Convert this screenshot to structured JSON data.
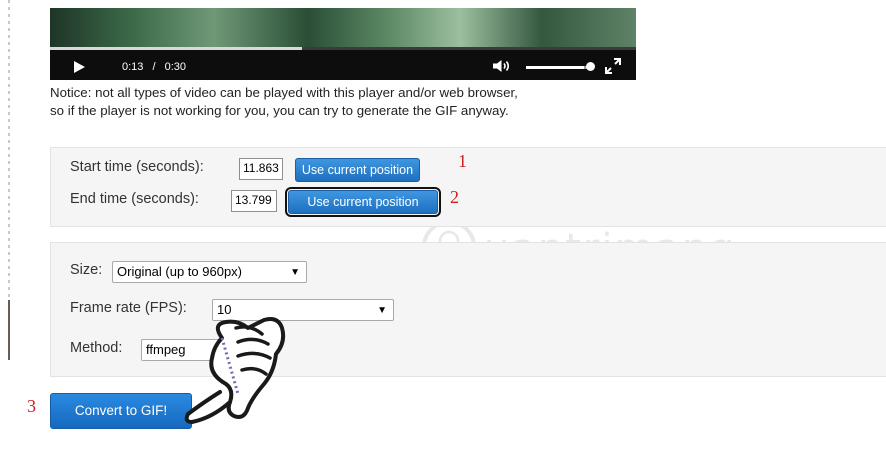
{
  "video": {
    "current_time": "0:13",
    "separator": "/",
    "duration": "0:30",
    "progress_fraction": 0.43,
    "volume_fraction": 0.9
  },
  "notice": {
    "line1": "Notice: not all types of video can be played with this player and/or web browser,",
    "line2": "so if the player is not working for you, you can try to generate the GIF anyway."
  },
  "timing": {
    "start_label": "Start time (seconds):",
    "start_value": "11.863",
    "end_label": "End time (seconds):",
    "end_value": "13.799",
    "use_position_label": "Use current position"
  },
  "options": {
    "size_label": "Size:",
    "size_value": "Original (up to 960px)",
    "fps_label": "Frame rate (FPS):",
    "fps_value": "10",
    "method_label": "Method:",
    "method_value": "ffmpeg"
  },
  "convert_label": "Convert to GIF!",
  "annotations": {
    "step1": "1",
    "step2": "2",
    "step3": "3"
  },
  "watermark": "uantrimang",
  "colors": {
    "button_blue": "#1f6fc0",
    "annotation_red": "#cc1f1f",
    "panel_bg": "#f5f5f5"
  }
}
